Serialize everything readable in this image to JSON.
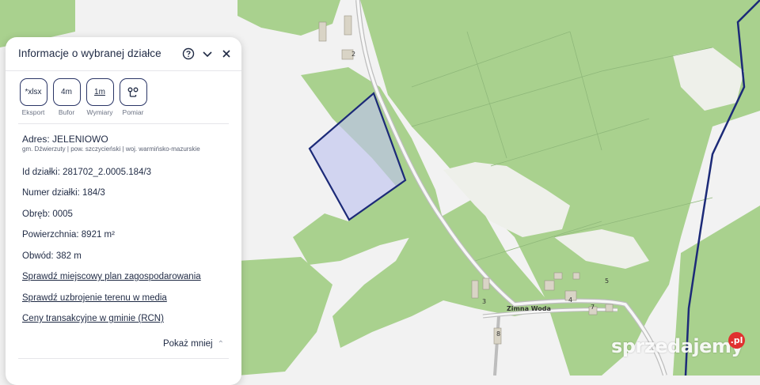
{
  "panel": {
    "title": "Informacje o wybranej działce",
    "icons": [
      "help-icon",
      "chevron-down-icon",
      "close-icon"
    ],
    "tools": [
      {
        "name": "export",
        "glyph": "*xlsx",
        "label": "Eksport"
      },
      {
        "name": "buffer",
        "glyph": "4m",
        "label": "Bufor"
      },
      {
        "name": "dimensions",
        "glyph": "1m",
        "label": "Wymiary"
      },
      {
        "name": "measure",
        "glyph": "measure-icon",
        "label": "Pomiar"
      }
    ],
    "address": "Adres: JELENIOWO",
    "address_sub": "gm. Dźwierzuty | pow. szczycieński | woj. warmińsko-mazurskie",
    "fields": {
      "id": "Id działki: 281702_2.0005.184/3",
      "number": "Numer działki: 184/3",
      "precinct": "Obręb: 0005",
      "area": "Powierzchnia: 8921 m²",
      "perimeter": "Obwód: 382 m"
    },
    "links": {
      "plan": "Sprawdź miejscowy plan zagospodarowania",
      "utilities": "Sprawdź uzbrojenie terenu w media",
      "prices": "Ceny transakcyjne w gminie (RCN)"
    },
    "show_less": "Pokaż mniej"
  },
  "map": {
    "village_label": "Zimna Woda",
    "building_numbers": [
      "2",
      "3",
      "4",
      "5",
      "7",
      "8"
    ],
    "colors": {
      "forest": "#a9d18e",
      "open_land": "#f2f2f2",
      "parcel_fill": "#c7c9ef",
      "parcel_border": "#1c2a78",
      "boundary": "#1c2a78"
    }
  },
  "watermark": {
    "text": "sprzedajemy",
    "badge": ".pl"
  }
}
